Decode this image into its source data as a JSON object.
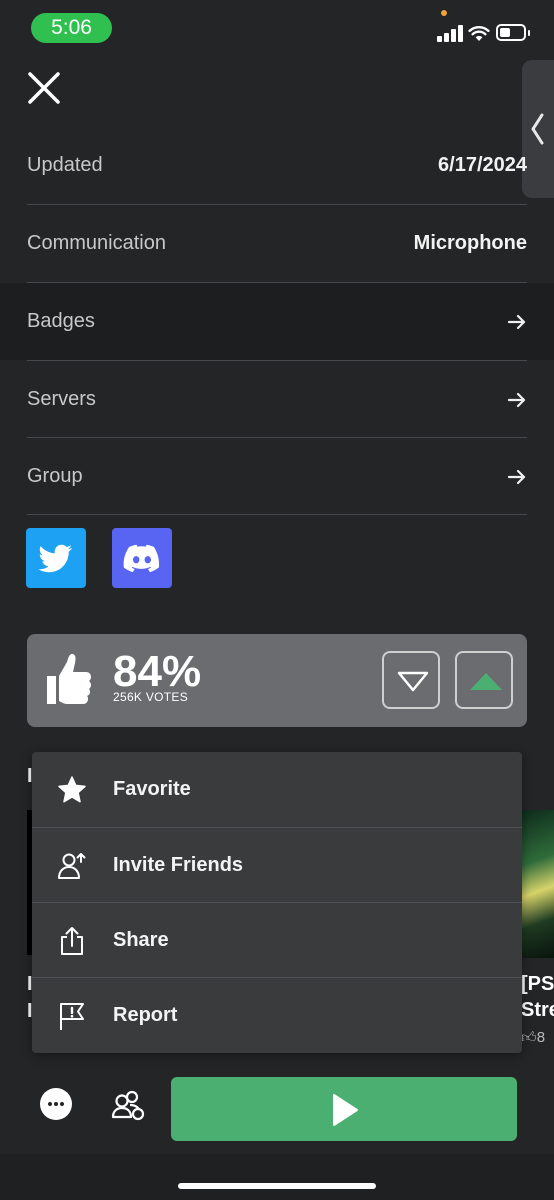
{
  "status_bar": {
    "time": "5:06"
  },
  "details": {
    "updated": {
      "label": "Updated",
      "value": "6/17/2024"
    },
    "communication": {
      "label": "Communication",
      "value": "Microphone"
    },
    "badges": {
      "label": "Badges"
    },
    "servers": {
      "label": "Servers"
    },
    "group": {
      "label": "Group"
    }
  },
  "social_links": [
    {
      "name": "twitter",
      "color": "#1da1f2"
    },
    {
      "name": "discord",
      "color": "#5865f2"
    }
  ],
  "rating": {
    "percent": "84%",
    "votes": "256K VOTES",
    "upvote_color": "#4caf72"
  },
  "background_peek": {
    "left_title_fragment": "I",
    "left_line1": "I",
    "left_line2": "I",
    "right_line1": "[PS",
    "right_line2": "Stre",
    "right_rating": "8"
  },
  "context_menu": {
    "items": [
      {
        "label": "Favorite",
        "icon": "star-icon"
      },
      {
        "label": "Invite Friends",
        "icon": "invite-friend-icon"
      },
      {
        "label": "Share",
        "icon": "share-icon"
      },
      {
        "label": "Report",
        "icon": "report-flag-icon"
      }
    ]
  },
  "bottom_bar": {
    "play_color": "#4caf72"
  }
}
